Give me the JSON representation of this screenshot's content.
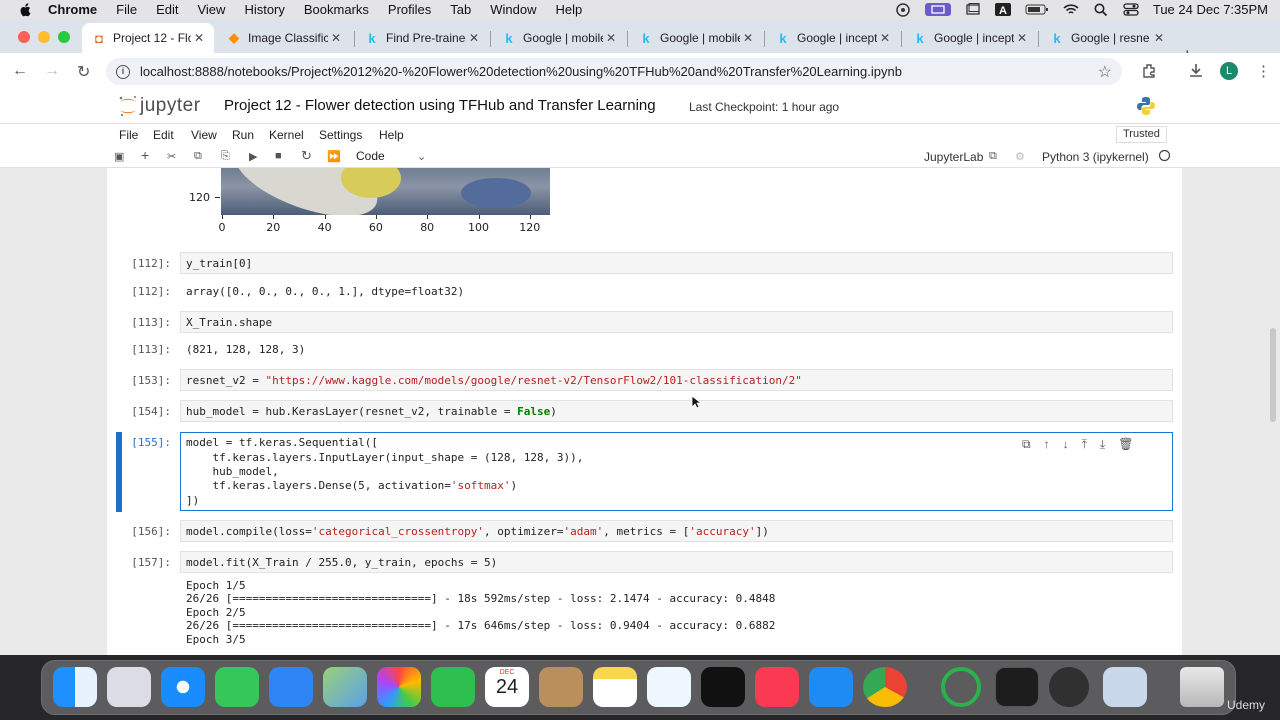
{
  "menubar": {
    "app": "Chrome",
    "items": [
      "File",
      "Edit",
      "View",
      "History",
      "Bookmarks",
      "Profiles",
      "Tab",
      "Window",
      "Help"
    ],
    "datetime": "Tue 24 Dec  7:35PM"
  },
  "tabs": [
    {
      "label": "Project 12 - Flo",
      "icon": "jupyter-icon",
      "active": true
    },
    {
      "label": "Image Classificati",
      "icon": "tensorflow-icon"
    },
    {
      "label": "Find Pre-trained",
      "icon": "kaggle-icon"
    },
    {
      "label": "Google | mobile",
      "icon": "kaggle-icon"
    },
    {
      "label": "Google | mobile",
      "icon": "kaggle-icon"
    },
    {
      "label": "Google | incepti",
      "icon": "kaggle-icon"
    },
    {
      "label": "Google | incepti",
      "icon": "kaggle-icon"
    },
    {
      "label": "Google | resne",
      "icon": "kaggle-icon"
    }
  ],
  "address": {
    "url": "localhost:8888/notebooks/Project%2012%20-%20Flower%20detection%20using%20TFHub%20and%20Transfer%20Learning.ipynb",
    "avatar": "L"
  },
  "jupyter": {
    "logo": "jupyter",
    "title": "Project 12 - Flower detection using TFHub and Transfer Learning",
    "checkpoint": "Last Checkpoint: 1 hour ago",
    "menu": [
      "File",
      "Edit",
      "View",
      "Run",
      "Kernel",
      "Settings",
      "Help"
    ],
    "trusted": "Trusted",
    "celltype": "Code",
    "jupyterlab": "JupyterLab",
    "kernel": "Python 3 (ipykernel)"
  },
  "plot": {
    "ytick": "120",
    "xticks": [
      "0",
      "20",
      "40",
      "60",
      "80",
      "100",
      "120"
    ]
  },
  "cells": {
    "c112_in": "[112]:",
    "c112_code": "y_train[0]",
    "c112_out": "[112]:",
    "c112_result": "array([0., 0., 0., 0., 1.], dtype=float32)",
    "c113_in": "[113]:",
    "c113_code": "X_Train.shape",
    "c113_out": "[113]:",
    "c113_result": "(821, 128, 128, 3)",
    "c153_in": "[153]:",
    "c153_var": "resnet_v2 = ",
    "c153_str": "\"https://www.kaggle.com/models/google/resnet-v2/TensorFlow2/101-classification/2\"",
    "c154_in": "[154]:",
    "c154_code": "hub_model = hub.KerasLayer(resnet_v2, trainable = ",
    "c154_false": "False",
    "c154_end": ")",
    "c155_in": "[155]:",
    "c155_l1": "model = tf.keras.Sequential([",
    "c155_l2": "    tf.keras.layers.InputLayer(input_shape = (128, 128, 3)),",
    "c155_l3": "    hub_model,",
    "c155_l4a": "    tf.keras.layers.Dense(5, activation=",
    "c155_l4b": "'softmax'",
    "c155_l4c": ")",
    "c155_l5": "])",
    "c156_in": "[156]:",
    "c156_a": "model.compile(loss=",
    "c156_b": "'categorical_crossentropy'",
    "c156_c": ", optimizer=",
    "c156_d": "'adam'",
    "c156_e": ", metrics = [",
    "c156_f": "'accuracy'",
    "c156_g": "])",
    "c157_in": "[157]:",
    "c157_code": "model.fit(X_Train / 255.0, y_train, epochs = 5)",
    "c157_out": [
      "Epoch 1/5",
      "26/26 [==============================] - 18s 592ms/step - loss: 2.1474 - accuracy: 0.4848",
      "Epoch 2/5",
      "26/26 [==============================] - 17s 646ms/step - loss: 0.9404 - accuracy: 0.6882",
      "Epoch 3/5"
    ]
  },
  "dock": {
    "calendar_month": "DEC",
    "calendar_day": "24",
    "udemy": "Udemy"
  }
}
